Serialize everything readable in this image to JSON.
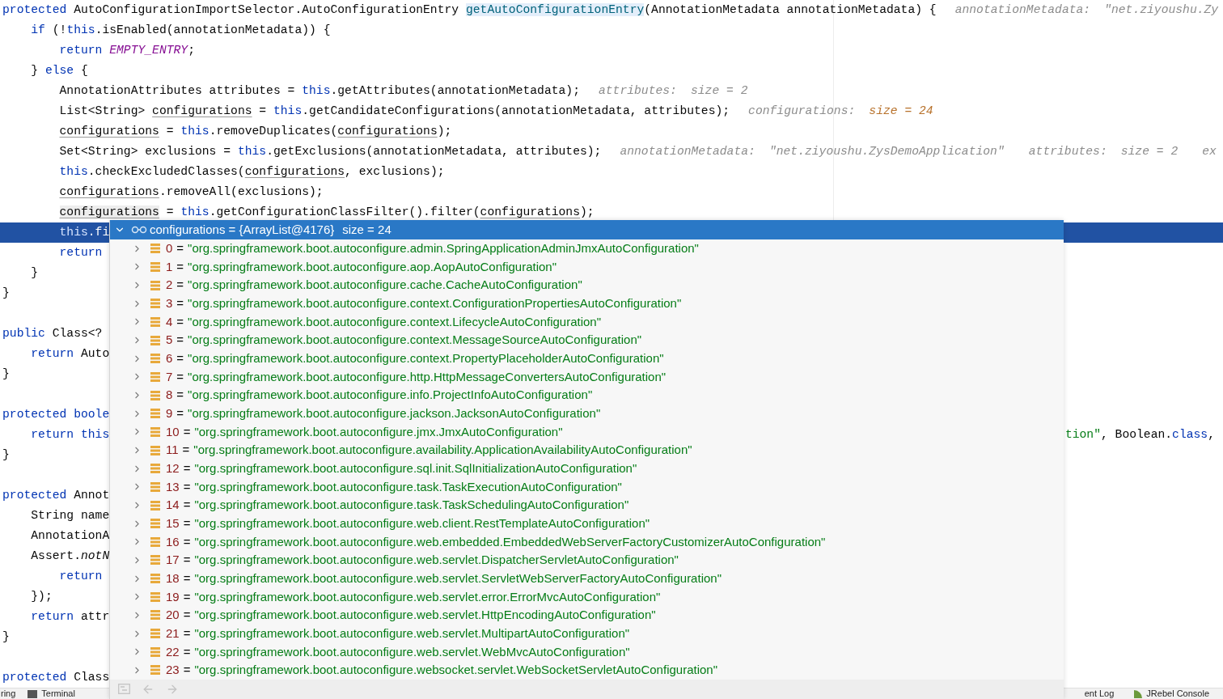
{
  "editor": {
    "rows": [
      {
        "kind": "code",
        "code": [
          {
            "kind": "kw",
            "text": "protected"
          },
          {
            "kind": "plain",
            "text": " AutoConfigurationImportSelector.AutoConfigurationEntry "
          },
          {
            "kind": "method-hl",
            "text": "getAutoConfigurationEntry"
          },
          {
            "kind": "plain",
            "text": "(AnnotationMetadata annotationMetadata) {"
          }
        ],
        "hints": [
          {
            "label": "annotationMetadata:",
            "value": "\"net.ziyoushu.Zy",
            "changed": false
          }
        ]
      },
      {
        "kind": "code",
        "code": [
          {
            "kind": "kw",
            "text": "    if"
          },
          {
            "kind": "plain",
            "text": " (!"
          },
          {
            "kind": "kw",
            "text": "this"
          },
          {
            "kind": "plain",
            "text": ".isEnabled(annotationMetadata)) {"
          }
        ]
      },
      {
        "kind": "code",
        "code": [
          {
            "kind": "kw",
            "text": "        return "
          },
          {
            "kind": "const",
            "text": "EMPTY_ENTRY"
          },
          {
            "kind": "plain",
            "text": ";"
          }
        ]
      },
      {
        "kind": "code",
        "code": [
          {
            "kind": "plain",
            "text": "    } "
          },
          {
            "kind": "kw",
            "text": "else"
          },
          {
            "kind": "plain",
            "text": " {"
          }
        ]
      },
      {
        "kind": "code",
        "code": [
          {
            "kind": "plain",
            "text": "        AnnotationAttributes attributes = "
          },
          {
            "kind": "kw",
            "text": "this"
          },
          {
            "kind": "plain",
            "text": ".getAttributes(annotationMetadata);"
          }
        ],
        "hints": [
          {
            "label": "attributes:",
            "value": "size = 2",
            "changed": false
          }
        ]
      },
      {
        "kind": "code",
        "code": [
          {
            "kind": "plain",
            "text": "        List<String> "
          },
          {
            "kind": "var",
            "text": "configurations"
          },
          {
            "kind": "plain",
            "text": " = "
          },
          {
            "kind": "kw",
            "text": "this"
          },
          {
            "kind": "plain",
            "text": ".getCandidateConfigurations(annotationMetadata, attributes);"
          }
        ],
        "hints": [
          {
            "label": "configurations:",
            "value": "size = 24",
            "changed": true
          }
        ]
      },
      {
        "kind": "code",
        "code": [
          {
            "kind": "var",
            "text": "        configurations"
          },
          {
            "kind": "plain",
            "text": " = "
          },
          {
            "kind": "kw",
            "text": "this"
          },
          {
            "kind": "plain",
            "text": ".removeDuplicates("
          },
          {
            "kind": "var",
            "text": "configurations"
          },
          {
            "kind": "plain",
            "text": ");"
          }
        ]
      },
      {
        "kind": "code",
        "code": [
          {
            "kind": "plain",
            "text": "        Set<String> exclusions = "
          },
          {
            "kind": "kw",
            "text": "this"
          },
          {
            "kind": "plain",
            "text": ".getExclusions(annotationMetadata, attributes);"
          }
        ],
        "hints": [
          {
            "label": "annotationMetadata:",
            "value": "\"net.ziyoushu.ZysDemoApplication\"",
            "changed": false
          },
          {
            "label": "attributes:",
            "value": "size = 2",
            "changed": false
          },
          {
            "label": "ex"
          }
        ]
      },
      {
        "kind": "code",
        "code": [
          {
            "kind": "kw",
            "text": "        this"
          },
          {
            "kind": "plain",
            "text": ".checkExcludedClasses("
          },
          {
            "kind": "var",
            "text": "configurations"
          },
          {
            "kind": "plain",
            "text": ", exclusions);"
          }
        ]
      },
      {
        "kind": "code",
        "code": [
          {
            "kind": "var",
            "text": "        configurations"
          },
          {
            "kind": "plain",
            "text": ".removeAll(exclusions);"
          }
        ]
      },
      {
        "kind": "code",
        "code": [
          {
            "kind": "var-hl",
            "text": "        configurations"
          },
          {
            "kind": "plain",
            "text": " = "
          },
          {
            "kind": "kw",
            "text": "this"
          },
          {
            "kind": "plain",
            "text": ".getConfigurationClassFilter().filter("
          },
          {
            "kind": "var",
            "text": "configurations"
          },
          {
            "kind": "plain",
            "text": ");"
          }
        ]
      },
      {
        "kind": "current",
        "code": [
          {
            "kind": "kw",
            "text": "        this"
          },
          {
            "kind": "plain",
            "text": ".fi"
          }
        ]
      },
      {
        "kind": "code",
        "code": [
          {
            "kind": "kw",
            "text": "        return"
          }
        ]
      },
      {
        "kind": "code",
        "code": [
          {
            "kind": "plain",
            "text": "    }"
          }
        ]
      },
      {
        "kind": "code",
        "code": [
          {
            "kind": "plain",
            "text": "}"
          }
        ]
      },
      {
        "kind": "blank"
      },
      {
        "kind": "code",
        "code": [
          {
            "kind": "kw",
            "text": "public"
          },
          {
            "kind": "plain",
            "text": " Class<?"
          }
        ]
      },
      {
        "kind": "code",
        "code": [
          {
            "kind": "kw",
            "text": "    return"
          },
          {
            "kind": "plain",
            "text": " Auto"
          }
        ]
      },
      {
        "kind": "code",
        "code": [
          {
            "kind": "plain",
            "text": "}"
          }
        ]
      },
      {
        "kind": "blank"
      },
      {
        "kind": "code",
        "code": [
          {
            "kind": "kw",
            "text": "protected boole"
          }
        ]
      },
      {
        "kind": "code",
        "code": [
          {
            "kind": "kw",
            "text": "    return this"
          }
        ],
        "right": [
          {
            "kind": "string",
            "text": "tion\""
          },
          {
            "kind": "plain",
            "text": ", Boolean."
          },
          {
            "kind": "kw",
            "text": "class"
          },
          {
            "kind": "plain",
            "text": ","
          }
        ]
      },
      {
        "kind": "code",
        "code": [
          {
            "kind": "plain",
            "text": "}"
          }
        ]
      },
      {
        "kind": "blank"
      },
      {
        "kind": "code",
        "code": [
          {
            "kind": "kw",
            "text": "protected"
          },
          {
            "kind": "plain",
            "text": " Annot"
          }
        ]
      },
      {
        "kind": "code",
        "code": [
          {
            "kind": "plain",
            "text": "    String name"
          }
        ]
      },
      {
        "kind": "code",
        "code": [
          {
            "kind": "plain",
            "text": "    AnnotationA"
          }
        ]
      },
      {
        "kind": "code",
        "code": [
          {
            "kind": "plain",
            "text": "    Assert."
          },
          {
            "kind": "italic",
            "text": "notN"
          }
        ]
      },
      {
        "kind": "code",
        "code": [
          {
            "kind": "kw",
            "text": "        return"
          }
        ]
      },
      {
        "kind": "code",
        "code": [
          {
            "kind": "plain",
            "text": "    });"
          }
        ]
      },
      {
        "kind": "code",
        "code": [
          {
            "kind": "kw",
            "text": "    return"
          },
          {
            "kind": "plain",
            "text": " attr"
          }
        ]
      },
      {
        "kind": "code",
        "code": [
          {
            "kind": "plain",
            "text": "}"
          }
        ]
      },
      {
        "kind": "blank"
      },
      {
        "kind": "code",
        "code": [
          {
            "kind": "kw",
            "text": "protected"
          },
          {
            "kind": "plain",
            "text": " Class"
          }
        ]
      }
    ]
  },
  "popup": {
    "title": "configurations = {ArrayList@4176}",
    "size": "size = 24",
    "expanded": true,
    "items": [
      {
        "index": "0",
        "sep": "=",
        "value": "\"org.springframework.boot.autoconfigure.admin.SpringApplicationAdminJmxAutoConfiguration\""
      },
      {
        "index": "1",
        "sep": "=",
        "value": "\"org.springframework.boot.autoconfigure.aop.AopAutoConfiguration\""
      },
      {
        "index": "2",
        "sep": "=",
        "value": "\"org.springframework.boot.autoconfigure.cache.CacheAutoConfiguration\""
      },
      {
        "index": "3",
        "sep": "=",
        "value": "\"org.springframework.boot.autoconfigure.context.ConfigurationPropertiesAutoConfiguration\""
      },
      {
        "index": "4",
        "sep": "=",
        "value": "\"org.springframework.boot.autoconfigure.context.LifecycleAutoConfiguration\""
      },
      {
        "index": "5",
        "sep": "=",
        "value": "\"org.springframework.boot.autoconfigure.context.MessageSourceAutoConfiguration\""
      },
      {
        "index": "6",
        "sep": "=",
        "value": "\"org.springframework.boot.autoconfigure.context.PropertyPlaceholderAutoConfiguration\""
      },
      {
        "index": "7",
        "sep": "=",
        "value": "\"org.springframework.boot.autoconfigure.http.HttpMessageConvertersAutoConfiguration\""
      },
      {
        "index": "8",
        "sep": "=",
        "value": "\"org.springframework.boot.autoconfigure.info.ProjectInfoAutoConfiguration\""
      },
      {
        "index": "9",
        "sep": "=",
        "value": "\"org.springframework.boot.autoconfigure.jackson.JacksonAutoConfiguration\""
      },
      {
        "index": "10",
        "sep": "=",
        "value": "\"org.springframework.boot.autoconfigure.jmx.JmxAutoConfiguration\""
      },
      {
        "index": "11",
        "sep": "=",
        "value": "\"org.springframework.boot.autoconfigure.availability.ApplicationAvailabilityAutoConfiguration\""
      },
      {
        "index": "12",
        "sep": "=",
        "value": "\"org.springframework.boot.autoconfigure.sql.init.SqlInitializationAutoConfiguration\""
      },
      {
        "index": "13",
        "sep": "=",
        "value": "\"org.springframework.boot.autoconfigure.task.TaskExecutionAutoConfiguration\""
      },
      {
        "index": "14",
        "sep": "=",
        "value": "\"org.springframework.boot.autoconfigure.task.TaskSchedulingAutoConfiguration\""
      },
      {
        "index": "15",
        "sep": "=",
        "value": "\"org.springframework.boot.autoconfigure.web.client.RestTemplateAutoConfiguration\""
      },
      {
        "index": "16",
        "sep": "=",
        "value": "\"org.springframework.boot.autoconfigure.web.embedded.EmbeddedWebServerFactoryCustomizerAutoConfiguration\""
      },
      {
        "index": "17",
        "sep": "=",
        "value": "\"org.springframework.boot.autoconfigure.web.servlet.DispatcherServletAutoConfiguration\""
      },
      {
        "index": "18",
        "sep": "=",
        "value": "\"org.springframework.boot.autoconfigure.web.servlet.ServletWebServerFactoryAutoConfiguration\""
      },
      {
        "index": "19",
        "sep": "=",
        "value": "\"org.springframework.boot.autoconfigure.web.servlet.error.ErrorMvcAutoConfiguration\""
      },
      {
        "index": "20",
        "sep": "=",
        "value": "\"org.springframework.boot.autoconfigure.web.servlet.HttpEncodingAutoConfiguration\""
      },
      {
        "index": "21",
        "sep": "=",
        "value": "\"org.springframework.boot.autoconfigure.web.servlet.MultipartAutoConfiguration\""
      },
      {
        "index": "22",
        "sep": "=",
        "value": "\"org.springframework.boot.autoconfigure.web.servlet.WebMvcAutoConfiguration\""
      },
      {
        "index": "23",
        "sep": "=",
        "value": "\"org.springframework.boot.autoconfigure.websocket.servlet.WebSocketServletAutoConfiguration\""
      }
    ]
  },
  "bottom_bar": {
    "left": [
      {
        "label": "ring",
        "kind": "text"
      },
      {
        "label": "Terminal",
        "kind": "terminal"
      }
    ],
    "right": [
      {
        "label": "ent Log",
        "kind": "text"
      },
      {
        "label": "JRebel Console",
        "kind": "jrebel"
      }
    ]
  }
}
